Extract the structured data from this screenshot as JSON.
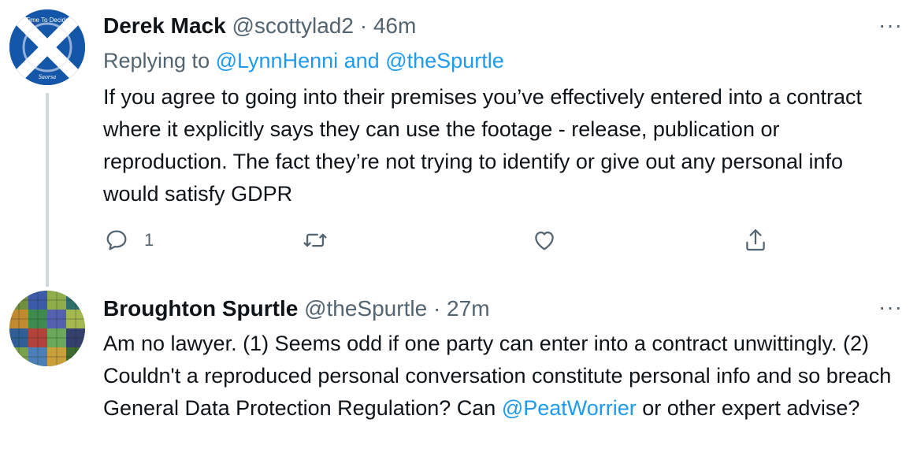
{
  "tweets": [
    {
      "display_name": "Derek Mack",
      "handle": "@scottylad2",
      "separator": "·",
      "time": "46m",
      "more_label": "···",
      "avatar_text_top": "Time To Decide",
      "avatar_text_bottom": "Saorsa",
      "reply_prefix": "Replying to",
      "reply_to_1": "@LynnHenni",
      "reply_and": "and",
      "reply_to_2": "@theSpurtle",
      "text": "If you agree to going into their premises you’ve effectively entered into a contract where it explicitly says they can use the footage - release, publication or reproduction. The fact they’re not trying to identify or give out any personal info would satisfy GDPR",
      "actions": {
        "reply_icon": "reply-icon",
        "reply_count": "1",
        "retweet_icon": "retweet-icon",
        "like_icon": "heart-icon",
        "share_icon": "share-icon"
      }
    },
    {
      "display_name": "Broughton Spurtle",
      "handle": "@theSpurtle",
      "separator": "·",
      "time": "27m",
      "more_label": "···",
      "text_part1": "Am no lawyer. (1) Seems odd if one party can enter into a contract unwittingly. (2) Couldn't a reproduced personal conversation constitute personal info and so breach General Data Protection Regulation? Can ",
      "mention": "@PeatWorrier",
      "text_part2": " or other expert advise?"
    }
  ],
  "colors": {
    "text": "#0f1419",
    "secondary": "#536471",
    "link": "#1d9bf0",
    "thread_line": "#cfd9de"
  }
}
